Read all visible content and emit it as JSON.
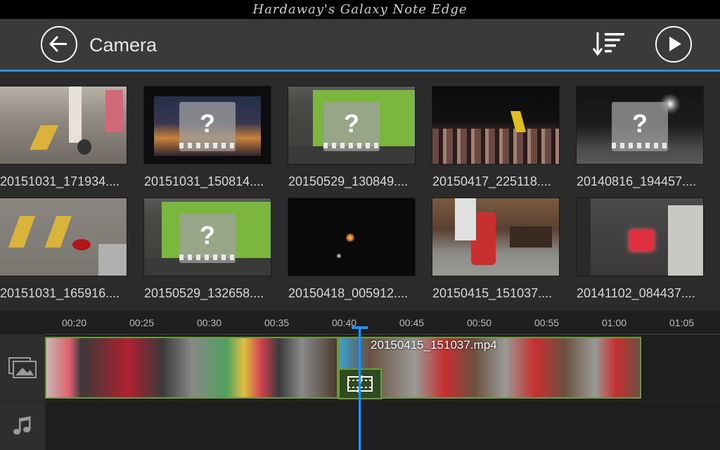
{
  "status_bar": {
    "title": "Hardaway's Galaxy Note Edge"
  },
  "header": {
    "title": "Camera"
  },
  "icons": {
    "back": "arrow-left-icon",
    "sort": "sort-icon",
    "play": "play-icon",
    "video_track": "image-icon",
    "audio_track": "music-note-icon",
    "transition": "transition-icon",
    "unknown": "question-mark-icon"
  },
  "colors": {
    "accent": "#2d8ed8",
    "clip_border": "#6a9b3a",
    "playhead": "#1e90ff"
  },
  "media": [
    {
      "caption": "20151031_171934...."
    },
    {
      "caption": "20151031_150814...."
    },
    {
      "caption": "20150529_130849...."
    },
    {
      "caption": "20150417_225118...."
    },
    {
      "caption": "20140816_194457...."
    },
    {
      "caption": "20151031_165916...."
    },
    {
      "caption": "20150529_132658...."
    },
    {
      "caption": "20150418_005912...."
    },
    {
      "caption": "20150415_151037...."
    },
    {
      "caption": "20141102_084437...."
    }
  ],
  "timeline": {
    "ticks": [
      "00:20",
      "00:25",
      "00:30",
      "00:35",
      "00:40",
      "00:45",
      "00:50",
      "00:55",
      "01:00",
      "01:05"
    ],
    "clip_label": "20150415_151037.mp4",
    "playhead_time": "00:41"
  }
}
